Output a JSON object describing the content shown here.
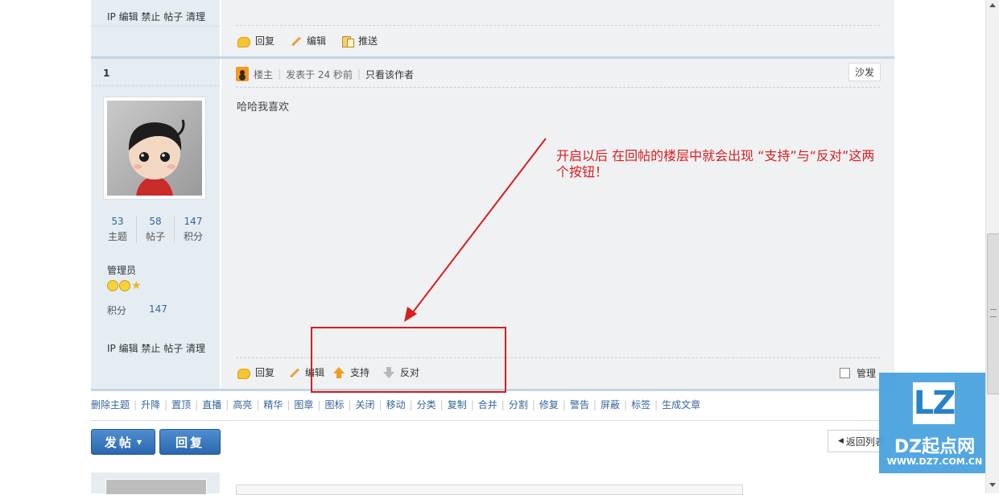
{
  "prev_post": {
    "admin_links": "IP 编辑 禁止 帖子 清理",
    "actions": [
      "回复",
      "编辑",
      "推送"
    ]
  },
  "post": {
    "floor_number": "1",
    "author_badge": "楼主",
    "posted_time": "发表于 24 秒前",
    "only_author": "只看该作者",
    "floor_label": "沙发",
    "content": "哈哈我喜欢",
    "stats": [
      {
        "value": "53",
        "label": "主题"
      },
      {
        "value": "58",
        "label": "帖子"
      },
      {
        "value": "147",
        "label": "积分"
      }
    ],
    "user_group": "管理员",
    "credits_label": "积分",
    "credits_value": "147",
    "admin_links": "IP 编辑 禁止 帖子 清理",
    "actions": {
      "reply": "回复",
      "edit": "编辑",
      "support": "支持",
      "oppose": "反对"
    },
    "manage_label": "管理"
  },
  "annotation": {
    "text_line1": "开启以后  在回帖的楼层中就会出现  “支持”与“反对”这两",
    "text_line2": "个按钮！",
    "color": "#d81e1e"
  },
  "mod_toolbar": [
    "删除主题",
    "升降",
    "置顶",
    "直播",
    "高亮",
    "精华",
    "图章",
    "图标",
    "关闭",
    "移动",
    "分类",
    "复制",
    "合并",
    "分割",
    "修复",
    "警告",
    "屏蔽",
    "标签",
    "生成文章"
  ],
  "buttons": {
    "post": "发帖",
    "reply": "回复",
    "back_to_list": "返回列表"
  },
  "watermark": {
    "logo": "LZ",
    "brand": "DZ起点网",
    "url": "WWW.DZ7.COM.CN"
  }
}
